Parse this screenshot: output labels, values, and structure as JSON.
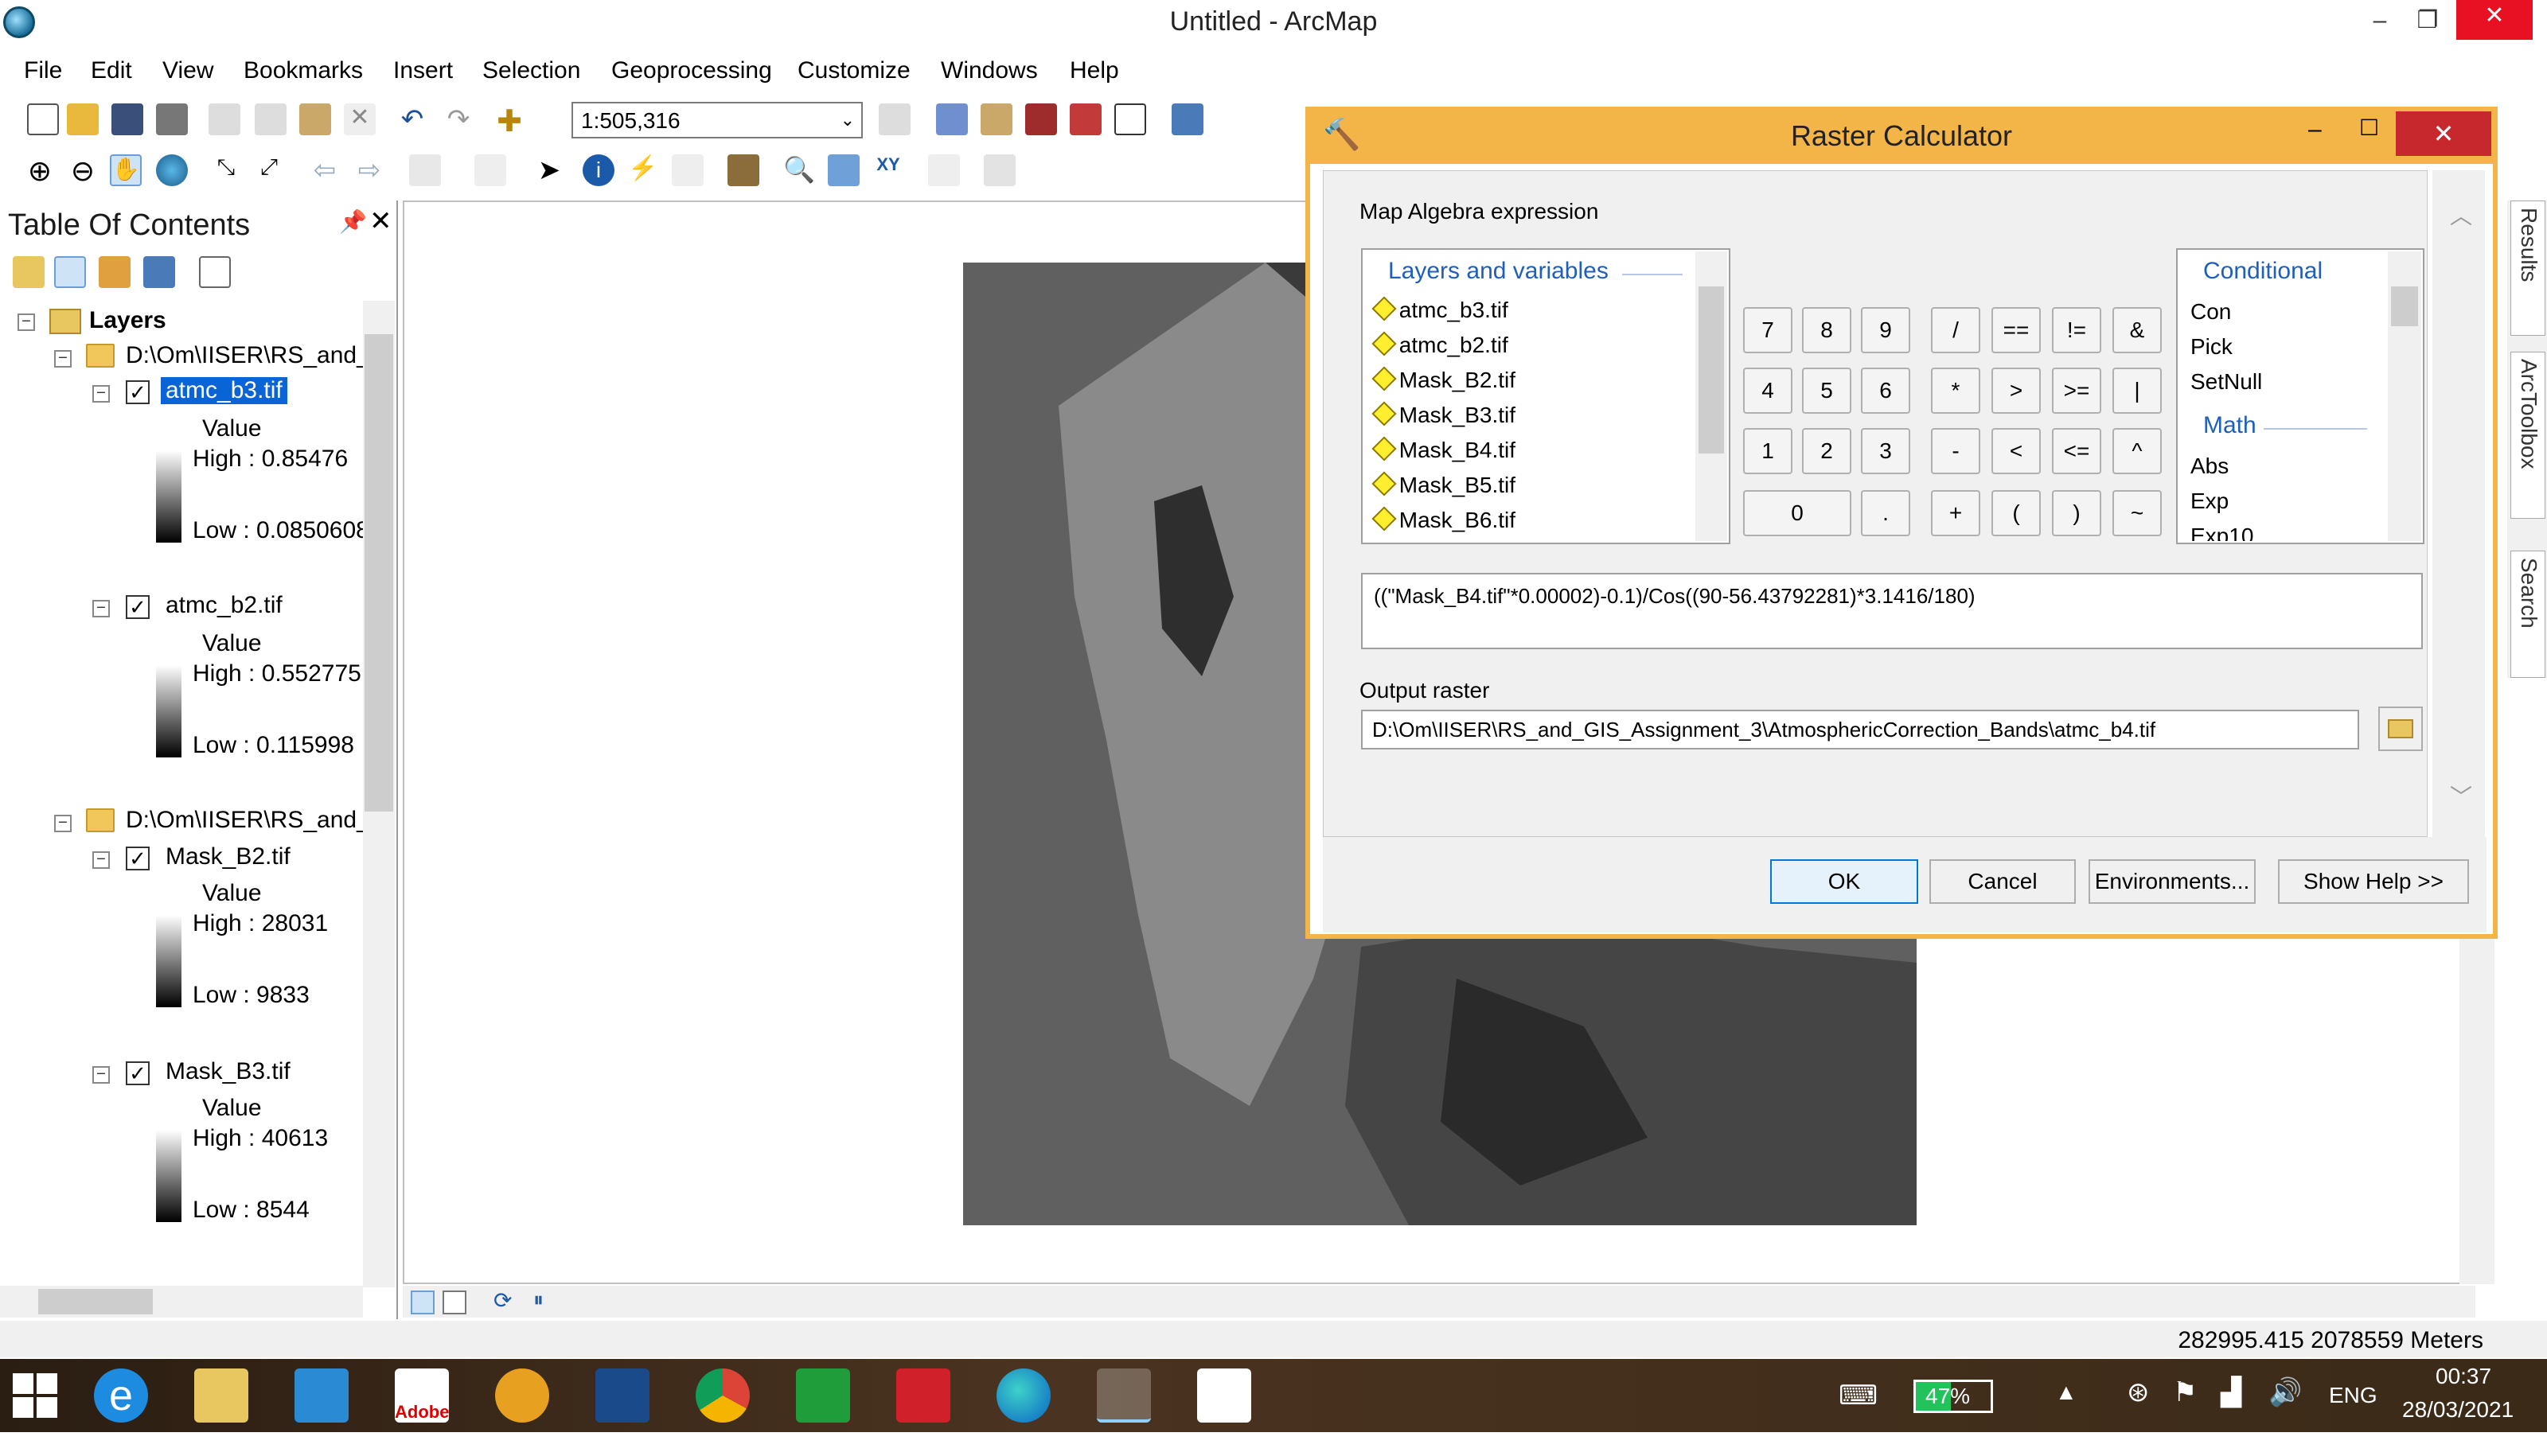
{
  "window": {
    "title": "Untitled - ArcMap",
    "minimize": "–",
    "restore": "❐",
    "close": "✕"
  },
  "menu": [
    "File",
    "Edit",
    "View",
    "Bookmarks",
    "Insert",
    "Selection",
    "Geoprocessing",
    "Customize",
    "Windows",
    "Help"
  ],
  "toolbar": {
    "scale": "1:505,316"
  },
  "toc": {
    "title": "Table Of Contents",
    "root": "Layers",
    "groups": [
      {
        "path": "D:\\Om\\IISER\\RS_and_(",
        "layers": [
          {
            "name": "atmc_b3.tif",
            "value_label": "Value",
            "high": "High : 0.85476",
            "low": "Low : 0.0850608",
            "selected": true
          },
          {
            "name": "atmc_b2.tif",
            "value_label": "Value",
            "high": "High : 0.552775",
            "low": "Low : 0.115998"
          }
        ]
      },
      {
        "path": "D:\\Om\\IISER\\RS_and_(",
        "layers": [
          {
            "name": "Mask_B2.tif",
            "value_label": "Value",
            "high": "High : 28031",
            "low": "Low : 9833"
          },
          {
            "name": "Mask_B3.tif",
            "value_label": "Value",
            "high": "High : 40613",
            "low": "Low : 8544"
          }
        ]
      }
    ]
  },
  "sidetabs": [
    "Results",
    "ArcToolbox",
    "Search"
  ],
  "dialog": {
    "title": "Raster Calculator",
    "expression_label": "Map Algebra expression",
    "layers_header": "Layers and variables",
    "layers": [
      "atmc_b3.tif",
      "atmc_b2.tif",
      "Mask_B2.tif",
      "Mask_B3.tif",
      "Mask_B4.tif",
      "Mask_B5.tif",
      "Mask_B6.tif"
    ],
    "keypad": [
      [
        "7",
        "8",
        "9",
        "/",
        "==",
        "!=",
        "&"
      ],
      [
        "4",
        "5",
        "6",
        "*",
        ">",
        ">=",
        "|"
      ],
      [
        "1",
        "2",
        "3",
        "-",
        "<",
        "<=",
        "^"
      ],
      [
        "0",
        ".",
        "+",
        "(",
        ")",
        "~"
      ]
    ],
    "functions": {
      "conditional_header": "Conditional",
      "conditional": [
        "Con",
        "Pick",
        "SetNull"
      ],
      "math_header": "Math",
      "math": [
        "Abs",
        "Exp",
        "Exp10"
      ]
    },
    "expression": "((\"Mask_B4.tif\"*0.00002)-0.1)/Cos((90-56.43792281)*3.1416/180)",
    "output_label": "Output raster",
    "output_path": "D:\\Om\\IISER\\RS_and_GIS_Assignment_3\\AtmosphericCorrection_Bands\\atmc_b4.tif",
    "buttons": {
      "ok": "OK",
      "cancel": "Cancel",
      "env": "Environments...",
      "help": "Show Help >>"
    }
  },
  "status": {
    "coords": "282995.415  2078559 Meters"
  },
  "taskbar": {
    "battery": "47%",
    "lang": "ENG",
    "time": "00:37",
    "date": "28/03/2021",
    "adobe": "Adobe"
  }
}
